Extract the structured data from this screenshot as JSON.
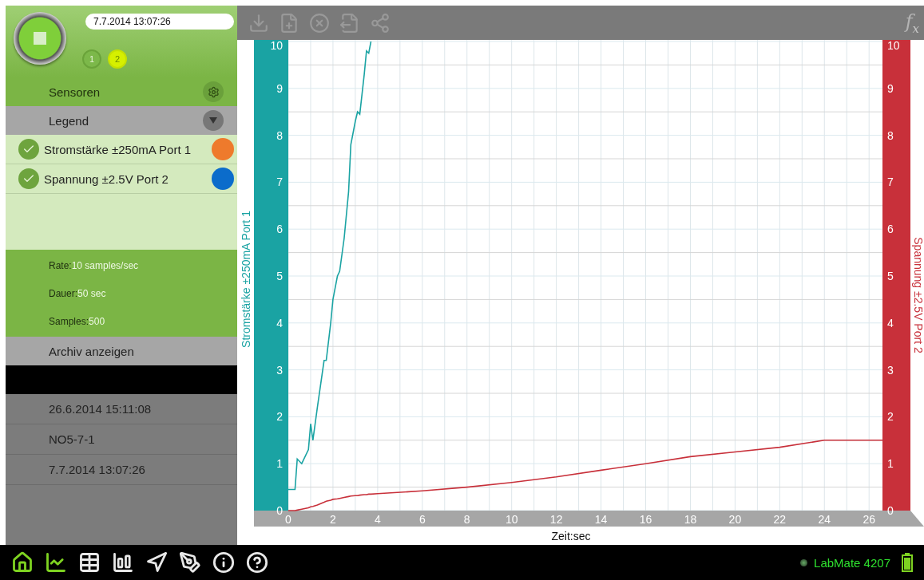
{
  "header": {
    "timestamp": "7.7.2014 13:07:26",
    "ports": [
      {
        "label": "1",
        "selected": false
      },
      {
        "label": "2",
        "selected": true
      }
    ]
  },
  "toolbar": {
    "fx": "f$_{x}$"
  },
  "sidebar": {
    "sensors_label": "Sensoren",
    "legend_label": "Legend",
    "legend_items": [
      {
        "label": "Stromstärke ±250mA Port 1",
        "checked": true,
        "color": "#ee7a2c"
      },
      {
        "label": "Spannung ±2.5V Port 2",
        "checked": true,
        "color": "#0b6ccb"
      }
    ],
    "info": [
      {
        "label": "Rate:",
        "value": "10 samples/sec"
      },
      {
        "label": "Dauer:",
        "value": "50 sec"
      },
      {
        "label": "Samples:",
        "value": "500"
      }
    ],
    "archive_label": "Archiv anzeigen",
    "archive_items": [
      "26.6.2014 15:11:08",
      "NO5-7-1",
      "7.7.2014 13:07:26"
    ]
  },
  "graph": {
    "left_axis_ticks": [
      "10",
      "9",
      "8",
      "7",
      "6",
      "5",
      "4",
      "3",
      "2",
      "1",
      "0"
    ],
    "right_axis_ticks": [
      "10",
      "9",
      "8",
      "7",
      "6",
      "5",
      "4",
      "3",
      "2",
      "1",
      "0"
    ],
    "chart_data": {
      "type": "line",
      "grid": true,
      "xlabel": "Zeit:sec",
      "xlim": [
        0,
        26.6
      ],
      "ylim": [
        0,
        10
      ],
      "xticks": [
        0,
        2,
        4,
        6,
        8,
        10,
        12,
        14,
        16,
        18,
        20,
        22,
        24,
        26
      ],
      "yticks": [
        0,
        1,
        2,
        3,
        4,
        5,
        6,
        7,
        8,
        9,
        10
      ],
      "x": [
        0,
        0.3,
        0.4,
        0.6,
        0.9,
        1.0,
        1.1,
        1.3,
        1.6,
        1.7,
        1.9,
        2.0,
        2.2,
        2.3,
        2.5,
        2.7,
        2.8,
        3.0,
        3.1,
        3.2,
        3.4,
        3.5,
        3.6,
        3.7,
        4,
        6,
        8,
        10,
        12,
        14,
        16,
        18,
        20,
        22,
        24,
        26.6
      ],
      "series": [
        {
          "name": "Stromstärke ±250mA Port 1",
          "color": "#1aa3a3",
          "values": [
            0.45,
            0.45,
            1.1,
            1.0,
            1.3,
            1.85,
            1.5,
            2.2,
            3.2,
            3.2,
            4.0,
            4.5,
            5.0,
            5.1,
            5.8,
            6.8,
            7.8,
            8.3,
            8.5,
            8.45,
            9.3,
            9.8,
            9.75,
            10.0,
            null,
            null,
            null,
            null,
            null,
            null,
            null,
            null,
            null,
            null,
            null,
            null
          ]
        },
        {
          "name": "Spannung ±2.5V Port 2",
          "color": "#c8303a",
          "values": [
            0,
            0,
            0.01,
            0.03,
            0.06,
            0.08,
            0.09,
            0.12,
            0.18,
            0.2,
            0.22,
            0.24,
            0.25,
            0.26,
            0.28,
            0.3,
            0.31,
            0.32,
            0.32,
            0.33,
            0.34,
            0.34,
            0.35,
            0.35,
            0.36,
            0.42,
            0.5,
            0.6,
            0.72,
            0.86,
            1.0,
            1.15,
            1.25,
            1.35,
            1.5,
            1.5
          ]
        }
      ]
    }
  },
  "bottom_bar": {
    "nav": [
      {
        "kind": "home",
        "selected": true
      },
      {
        "kind": "graph",
        "selected": true
      },
      {
        "kind": "table",
        "selected": false
      },
      {
        "kind": "bars",
        "selected": false
      },
      {
        "kind": "navigate",
        "selected": false
      },
      {
        "kind": "pen",
        "selected": false
      },
      {
        "kind": "info",
        "selected": false
      },
      {
        "kind": "help",
        "selected": false
      }
    ],
    "device": "LabMate 4207"
  }
}
